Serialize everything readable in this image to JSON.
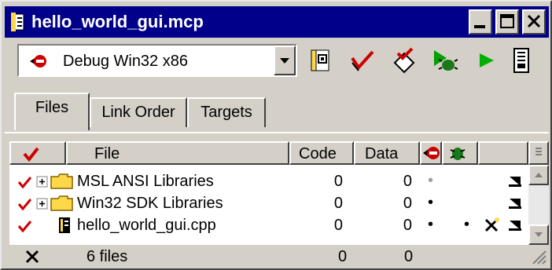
{
  "window": {
    "title": "hello_world_gui.mcp"
  },
  "toolbar": {
    "target_selected": "Debug Win32 x86"
  },
  "tabs": [
    {
      "label": "Files"
    },
    {
      "label": "Link Order"
    },
    {
      "label": "Targets"
    }
  ],
  "columns": {
    "file": "File",
    "code": "Code",
    "data": "Data"
  },
  "rows": [
    {
      "name": "MSL ANSI Libraries",
      "code": "0",
      "data": "0"
    },
    {
      "name": "Win32 SDK Libraries",
      "code": "0",
      "data": "0"
    },
    {
      "name": "hello_world_gui.cpp",
      "code": "0",
      "data": "0"
    }
  ],
  "status": {
    "files": "6 files",
    "code_total": "0",
    "data_total": "0"
  },
  "colors": {
    "title_bg": "#00008a",
    "check_red": "#cc0000",
    "folder_yellow": "#ffd84a",
    "run_green": "#00a000"
  }
}
